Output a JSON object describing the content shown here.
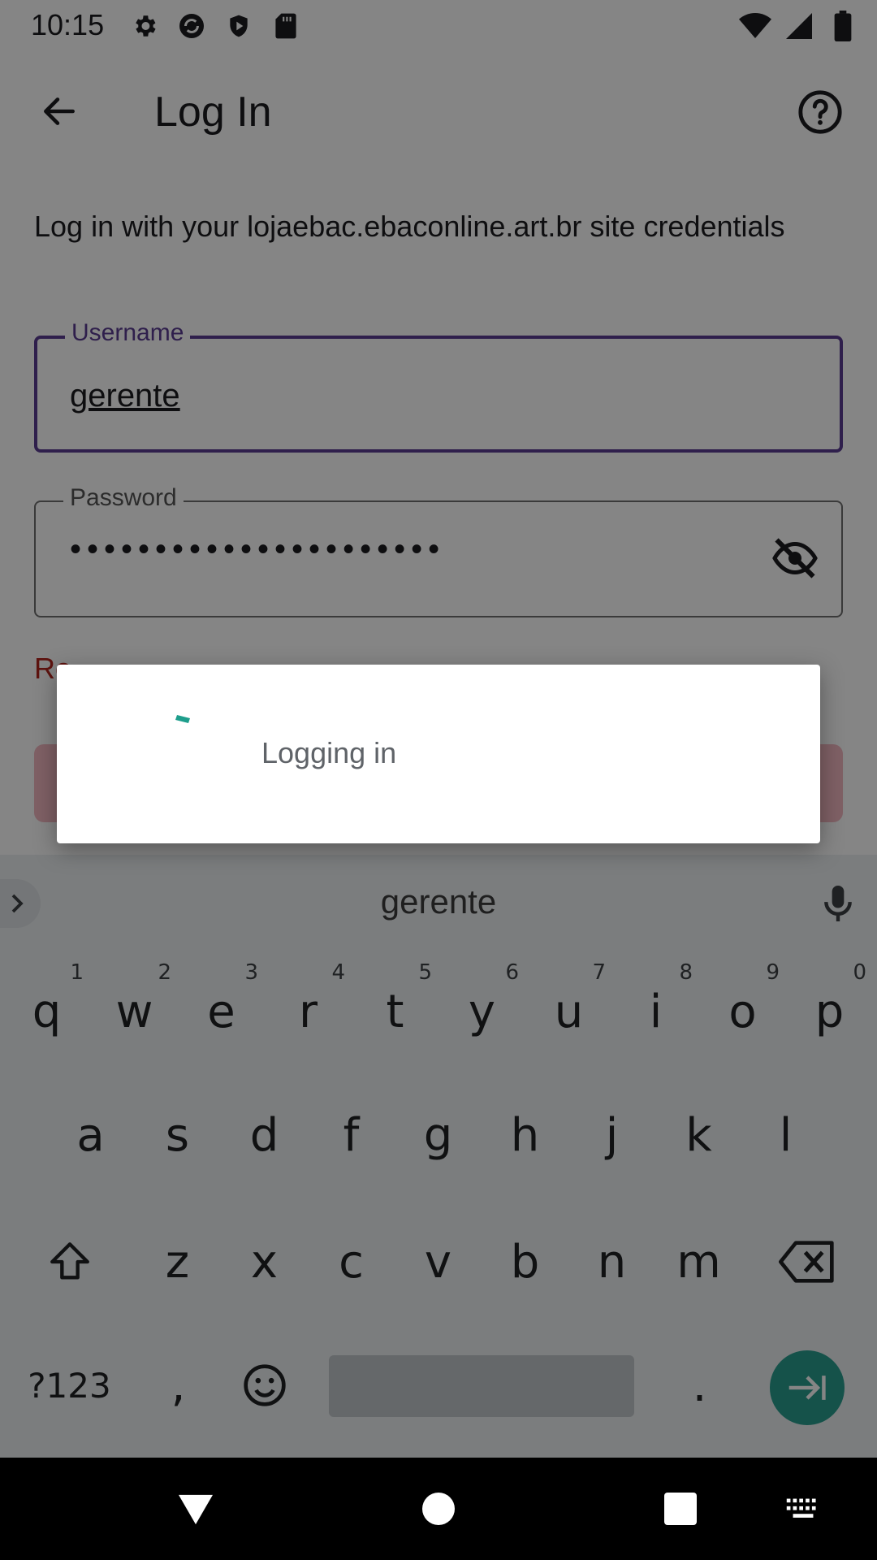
{
  "status_bar": {
    "time": "10:15",
    "left_icons": [
      "gear-icon",
      "sync-icon",
      "shield-icon",
      "sd-card-icon"
    ],
    "right_icons": [
      "wifi-icon",
      "cell-signal-icon",
      "battery-icon"
    ]
  },
  "app_bar": {
    "title": "Log In",
    "back_icon": "arrow-back-icon",
    "help_icon": "help-circle-icon"
  },
  "form": {
    "intro": "Log in with your lojaebac.ebaconline.art.br site credentials",
    "username": {
      "label": "Username",
      "value": "gerente"
    },
    "password": {
      "label": "Password",
      "masked_value": "••••••••••••••••••••••"
    },
    "reset_link_prefix": "Re"
  },
  "dialog": {
    "message": "Logging in"
  },
  "keyboard": {
    "suggestion": "gerente",
    "row1": [
      {
        "k": "q",
        "h": "1"
      },
      {
        "k": "w",
        "h": "2"
      },
      {
        "k": "e",
        "h": "3"
      },
      {
        "k": "r",
        "h": "4"
      },
      {
        "k": "t",
        "h": "5"
      },
      {
        "k": "y",
        "h": "6"
      },
      {
        "k": "u",
        "h": "7"
      },
      {
        "k": "i",
        "h": "8"
      },
      {
        "k": "o",
        "h": "9"
      },
      {
        "k": "p",
        "h": "0"
      }
    ],
    "row2": [
      "a",
      "s",
      "d",
      "f",
      "g",
      "h",
      "j",
      "k",
      "l"
    ],
    "row3": [
      "z",
      "x",
      "c",
      "v",
      "b",
      "n",
      "m"
    ],
    "symbols_key": "?123",
    "comma_key": ",",
    "period_key": "."
  },
  "colors": {
    "accent": "#5b3d93",
    "error": "#b3261e",
    "spinner": "#1e9e8c",
    "enter_key": "#2a9d8f"
  }
}
